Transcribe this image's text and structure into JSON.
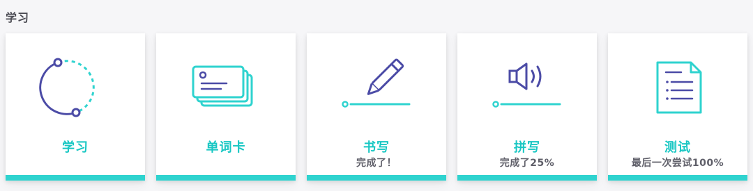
{
  "section": {
    "title": "学习"
  },
  "colors": {
    "accent": "#2fd3cf",
    "accent_text": "#18c7c3",
    "icon_purple": "#4b4ba6",
    "status_text": "#5f5f69"
  },
  "cards": [
    {
      "icon": "circular-progress-icon",
      "label": "学习",
      "status": ""
    },
    {
      "icon": "flashcards-icon",
      "label": "单词卡",
      "status": ""
    },
    {
      "icon": "pencil-icon",
      "label": "书写",
      "status": "完成了！"
    },
    {
      "icon": "speaker-icon",
      "label": "拼写",
      "status": "完成了25%"
    },
    {
      "icon": "document-list-icon",
      "label": "测试",
      "status": "最后一次尝试100%"
    }
  ]
}
